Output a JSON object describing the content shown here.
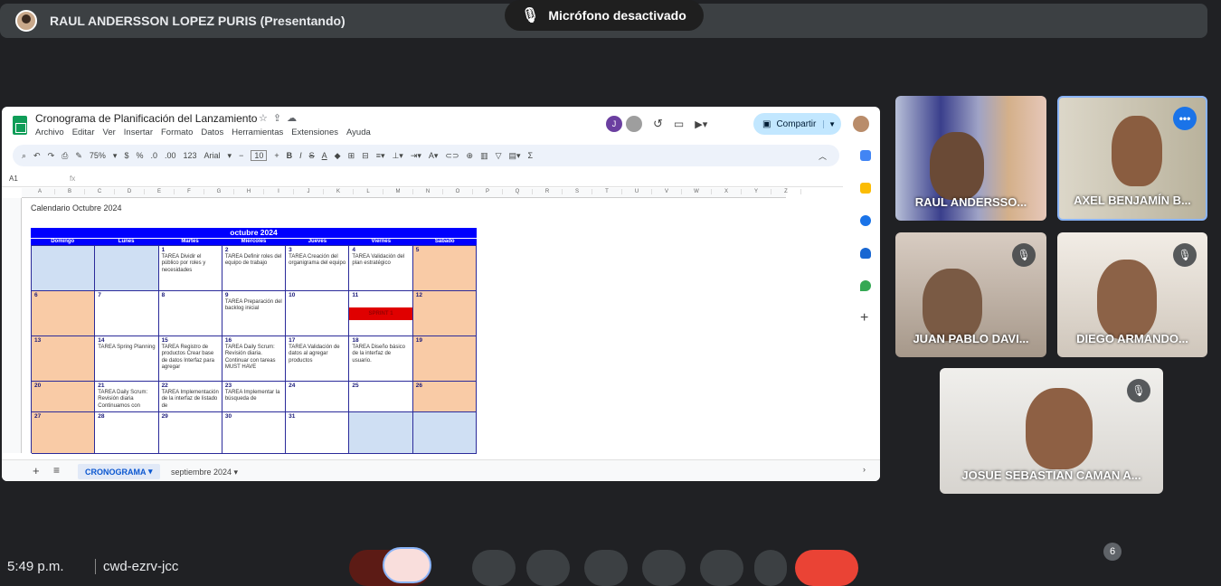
{
  "meeting": {
    "presenter": "RAUL ANDERSSON LOPEZ PURIS (Presentando)",
    "mic_status": "Micrófono desactivado",
    "time": "5:49 p.m.",
    "meeting_code": "cwd-ezrv-jcc",
    "participant_count": "6"
  },
  "sheet": {
    "title": "Cronograma de Planificación del Lanzamiento",
    "menu": [
      "Archivo",
      "Editar",
      "Ver",
      "Insertar",
      "Formato",
      "Datos",
      "Herramientas",
      "Extensiones",
      "Ayuda"
    ],
    "share_label": "Compartir",
    "collab_initial": "J",
    "toolbar": {
      "zoom": "75%",
      "currency": "$",
      "percent": "%",
      "dec_less": ".0",
      "dec_more": ".00",
      "number_fmt": "123",
      "font": "Arial",
      "font_size": "10",
      "minus": "−",
      "plus": "+",
      "bold": "B",
      "italic": "I",
      "strike": "S",
      "textcolor": "A",
      "sigma": "Σ"
    },
    "cell_ref": "A1",
    "fx": "fx",
    "columns": [
      "A",
      "B",
      "C",
      "D",
      "E",
      "F",
      "G",
      "H",
      "I",
      "J",
      "K",
      "L",
      "M",
      "N",
      "O",
      "P",
      "Q",
      "R",
      "S",
      "T",
      "U",
      "V",
      "W",
      "X",
      "Y",
      "Z"
    ],
    "calendar_title": "Calendario Octubre 2024",
    "month_header": "octubre 2024",
    "weekdays": [
      "Domingo",
      "Lunes",
      "Martes",
      "Miércoles",
      "Jueves",
      "Viernes",
      "Sábado"
    ],
    "sprint_label": "SPRINT 1",
    "tabs": {
      "active": "CRONOGRAMA",
      "other": "septiembre 2024"
    },
    "weeks": [
      [
        {
          "d": "",
          "t": "",
          "bg": "bl"
        },
        {
          "d": "",
          "t": "",
          "bg": "bl"
        },
        {
          "d": "1",
          "t": "TAREA Dividir el público por roles y necesidades",
          "bg": ""
        },
        {
          "d": "2",
          "t": "TAREA Definir roles del equipo de trabajo",
          "bg": ""
        },
        {
          "d": "3",
          "t": "TAREA Creación del organigrama del equipo",
          "bg": ""
        },
        {
          "d": "4",
          "t": "TAREA Validación del plan estratégico",
          "bg": ""
        },
        {
          "d": "5",
          "t": "",
          "bg": "we"
        }
      ],
      [
        {
          "d": "6",
          "t": "",
          "bg": "we"
        },
        {
          "d": "7",
          "t": "",
          "bg": ""
        },
        {
          "d": "8",
          "t": "",
          "bg": ""
        },
        {
          "d": "9",
          "t": "TAREA Preparación del backlog inicial",
          "bg": ""
        },
        {
          "d": "10",
          "t": "",
          "bg": ""
        },
        {
          "d": "11",
          "t": "",
          "bg": "",
          "sprint": true
        },
        {
          "d": "12",
          "t": "",
          "bg": "we"
        }
      ],
      [
        {
          "d": "13",
          "t": "",
          "bg": "we"
        },
        {
          "d": "14",
          "t": "TAREA Spring Planning",
          "bg": ""
        },
        {
          "d": "15",
          "t": "TAREA Registro de productos Crear base de datos Interfaz para agregar",
          "bg": ""
        },
        {
          "d": "16",
          "t": "TAREA Daily Scrum: Revisión diaria. Continuar con tareas MUST HAVE",
          "bg": ""
        },
        {
          "d": "17",
          "t": "TAREA Validación de datos al agregar productos",
          "bg": ""
        },
        {
          "d": "18",
          "t": "TAREA Diseño básico de la interfaz de usuario.",
          "bg": ""
        },
        {
          "d": "19",
          "t": "",
          "bg": "we"
        }
      ],
      [
        {
          "d": "20",
          "t": "",
          "bg": "we"
        },
        {
          "d": "21",
          "t": "TAREA Daily Scrum: Revisión diaria Continuamos con",
          "bg": ""
        },
        {
          "d": "22",
          "t": "TAREA Implementación de la interfaz de listado de",
          "bg": ""
        },
        {
          "d": "23",
          "t": "TAREA Implementar la búsqueda de",
          "bg": ""
        },
        {
          "d": "24",
          "t": "",
          "bg": ""
        },
        {
          "d": "25",
          "t": "",
          "bg": ""
        },
        {
          "d": "26",
          "t": "",
          "bg": "we"
        }
      ],
      [
        {
          "d": "27",
          "t": "",
          "bg": "we"
        },
        {
          "d": "28",
          "t": "",
          "bg": ""
        },
        {
          "d": "29",
          "t": "",
          "bg": ""
        },
        {
          "d": "30",
          "t": "",
          "bg": ""
        },
        {
          "d": "31",
          "t": "",
          "bg": ""
        },
        {
          "d": "",
          "t": "",
          "bg": "bl"
        },
        {
          "d": "",
          "t": "",
          "bg": "bl"
        }
      ]
    ]
  },
  "participants": [
    {
      "name": "RAUL ANDERSSO...",
      "muted": false
    },
    {
      "name": "AXEL BENJAMÍN B...",
      "muted": false,
      "speaking": true
    },
    {
      "name": "JUAN PABLO DAVI...",
      "muted": true
    },
    {
      "name": "DIEGO ARMANDO...",
      "muted": true
    },
    {
      "name": "JOSUE SEBASTIAN CAMAN A...",
      "muted": true
    }
  ]
}
